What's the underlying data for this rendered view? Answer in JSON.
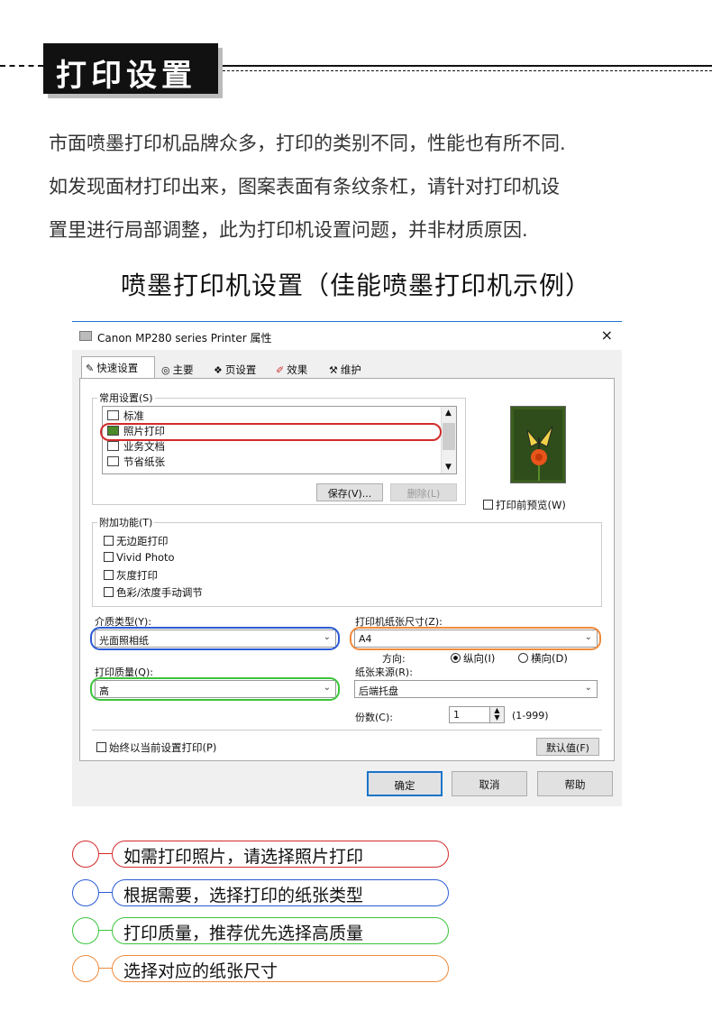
{
  "header": {
    "title": "打印设置"
  },
  "intro": {
    "line1": "市面喷墨打印机品牌众多，打印的类别不同，性能也有所不同.",
    "line2": "如发现面材打印出来，图案表面有条纹条杠，请针对打印机设",
    "line3": "置里进行局部调整，此为打印机设置问题，并非材质原因."
  },
  "subtitle": "喷墨打印机设置（佳能喷墨打印机示例）",
  "dialog": {
    "title": "Canon MP280 series Printer 属性",
    "close": "×",
    "tabs": [
      "快速设置",
      "主要",
      "页设置",
      "效果",
      "维护"
    ],
    "common": {
      "label": "常用设置(S)",
      "items": [
        "标准",
        "照片打印",
        "业务文档",
        "节省纸张"
      ],
      "save": "保存(V)...",
      "delete": "删除(L)"
    },
    "preview_check": "打印前预览(W)",
    "addon": {
      "label": "附加功能(T)",
      "items": [
        "无边距打印",
        "Vivid Photo",
        "灰度打印",
        "色彩/浓度手动调节"
      ]
    },
    "media": {
      "label": "介质类型(Y):",
      "value": "光面照相纸"
    },
    "paper_size": {
      "label": "打印机纸张尺寸(Z):",
      "value": "A4"
    },
    "orientation": {
      "label": "方向:",
      "portrait": "纵向(I)",
      "landscape": "横向(D)"
    },
    "quality": {
      "label": "打印质量(Q):",
      "value": "高"
    },
    "source": {
      "label": "纸张来源(R):",
      "value": "后端托盘"
    },
    "copies": {
      "label": "份数(C):",
      "value": "1",
      "range": "(1-999)"
    },
    "always_check": "始终以当前设置打印(P)",
    "defaults": "默认值(F)",
    "ok": "确定",
    "cancel": "取消",
    "help": "帮助"
  },
  "legend": [
    {
      "text": "如需打印照片，请选择照片打印",
      "color": "#d42a2a"
    },
    {
      "text": "根据需要，选择打印的纸张类型",
      "color": "#2a5bd4"
    },
    {
      "text": "打印质量，推荐优先选择高质量",
      "color": "#3bc43b"
    },
    {
      "text": "选择对应的纸张尺寸",
      "color": "#f08a3c"
    }
  ],
  "colors": {
    "red": "#d42a2a",
    "blue": "#2a5bd4",
    "green": "#3bc43b",
    "orange": "#f08a3c"
  }
}
